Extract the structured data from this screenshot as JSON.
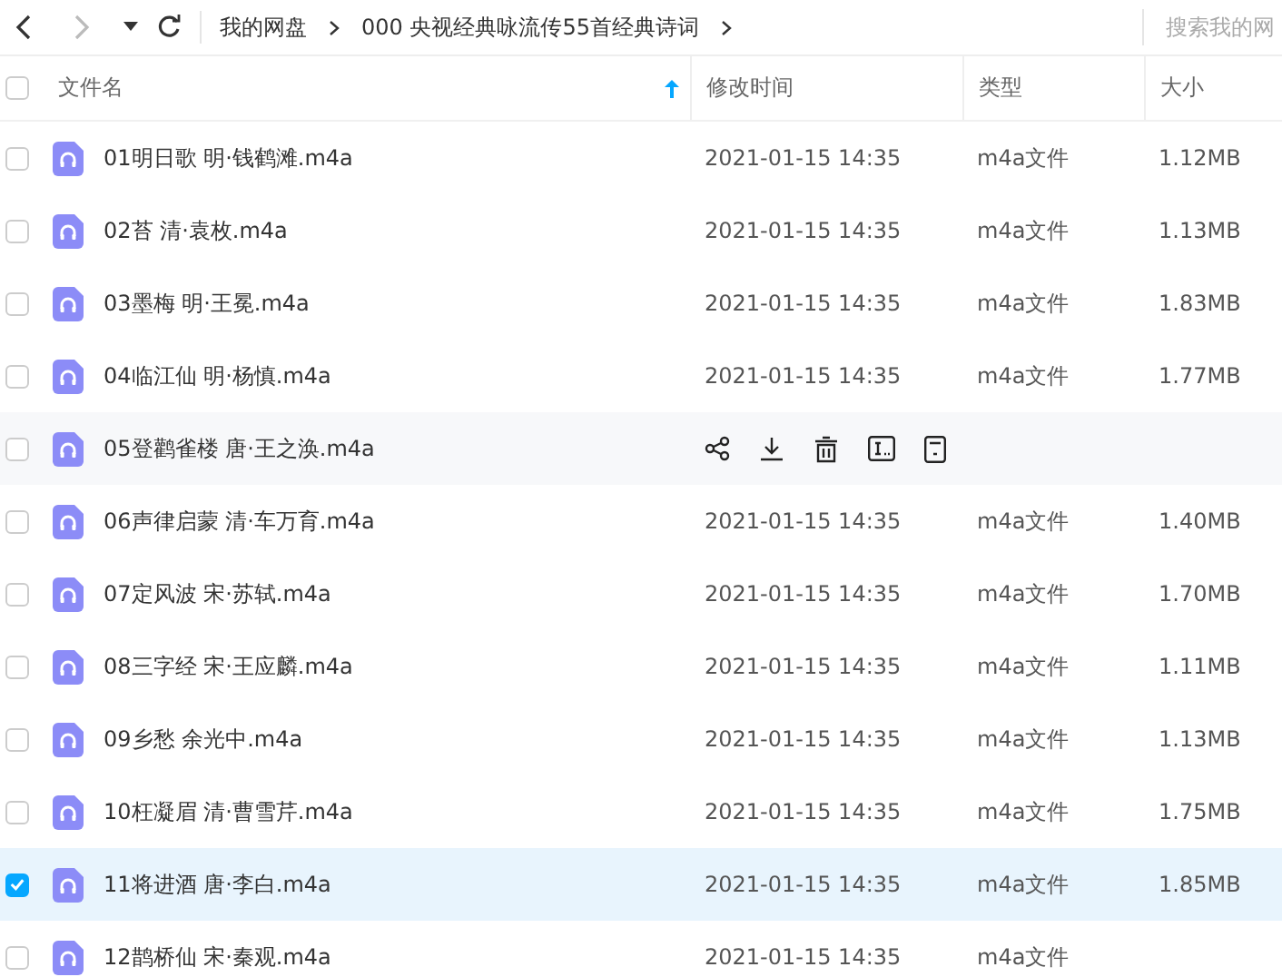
{
  "toolbar": {
    "breadcrumb": [
      "我的网盘",
      "000 央视经典咏流传55首经典诗词"
    ],
    "search": {
      "placeholder": "搜索我的网"
    }
  },
  "table": {
    "columns": [
      {
        "label": "文件名",
        "sorted": true
      },
      {
        "label": "修改时间",
        "sorted": false
      },
      {
        "label": "类型",
        "sorted": false
      },
      {
        "label": "大小",
        "sorted": false
      }
    ],
    "all_checked": false,
    "rows": [
      {
        "name": "01明日歌 明·钱鹤滩.m4a",
        "time": "2021-01-15 14:35",
        "type": "m4a文件",
        "size": "1.12MB",
        "selected": false,
        "hovered": false
      },
      {
        "name": "02苔 清·袁枚.m4a",
        "time": "2021-01-15 14:35",
        "type": "m4a文件",
        "size": "1.13MB",
        "selected": false,
        "hovered": false
      },
      {
        "name": "03墨梅 明·王冕.m4a",
        "time": "2021-01-15 14:35",
        "type": "m4a文件",
        "size": "1.83MB",
        "selected": false,
        "hovered": false
      },
      {
        "name": "04临江仙 明·杨慎.m4a",
        "time": "2021-01-15 14:35",
        "type": "m4a文件",
        "size": "1.77MB",
        "selected": false,
        "hovered": false
      },
      {
        "name": "05登鹳雀楼 唐·王之涣.m4a",
        "selected": false,
        "hovered": true
      },
      {
        "name": "06声律启蒙 清·车万育.m4a",
        "time": "2021-01-15 14:35",
        "type": "m4a文件",
        "size": "1.40MB",
        "selected": false,
        "hovered": false
      },
      {
        "name": "07定风波 宋·苏轼.m4a",
        "time": "2021-01-15 14:35",
        "type": "m4a文件",
        "size": "1.70MB",
        "selected": false,
        "hovered": false
      },
      {
        "name": "08三字经 宋·王应麟.m4a",
        "time": "2021-01-15 14:35",
        "type": "m4a文件",
        "size": "1.11MB",
        "selected": false,
        "hovered": false
      },
      {
        "name": "09乡愁 余光中.m4a",
        "time": "2021-01-15 14:35",
        "type": "m4a文件",
        "size": "1.13MB",
        "selected": false,
        "hovered": false
      },
      {
        "name": "10枉凝眉 清·曹雪芹.m4a",
        "time": "2021-01-15 14:35",
        "type": "m4a文件",
        "size": "1.75MB",
        "selected": false,
        "hovered": false
      },
      {
        "name": "11将进酒 唐·李白.m4a",
        "time": "2021-01-15 14:35",
        "type": "m4a文件",
        "size": "1.85MB",
        "selected": true,
        "hovered": false
      },
      {
        "name": "12鹊桥仙 宋·秦观.m4a",
        "time": "2021-01-15 14:35",
        "type": "m4a文件",
        "selected": false,
        "hovered": false
      }
    ]
  }
}
